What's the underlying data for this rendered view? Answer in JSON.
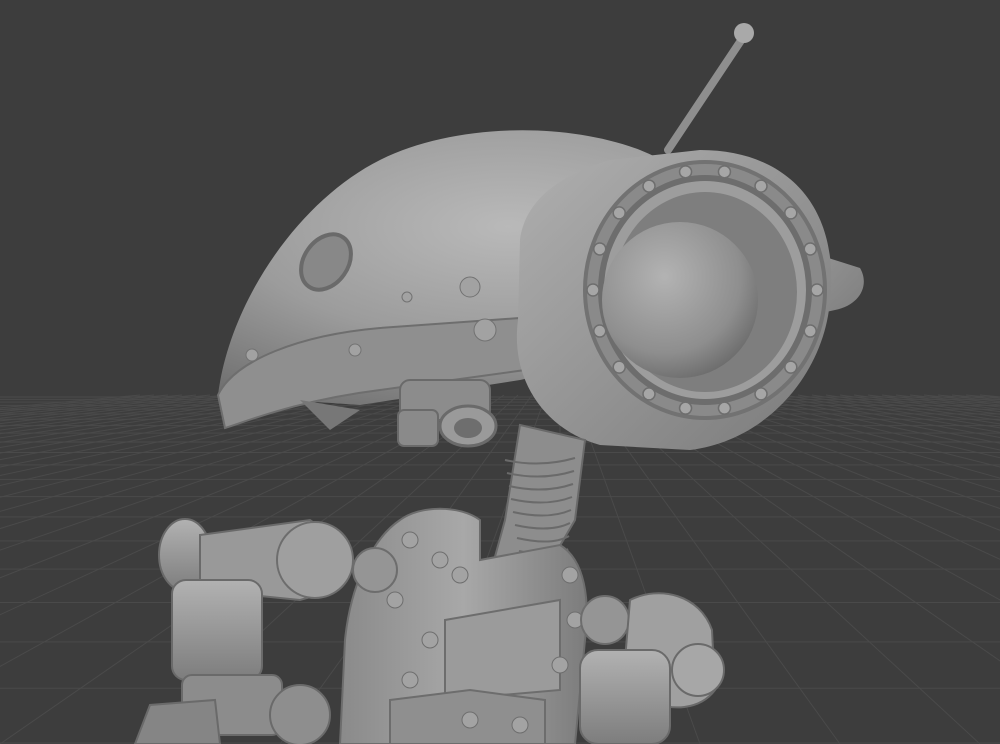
{
  "viewport": {
    "background_color": "#3d3d3d",
    "grid_color": "#4a4a4a",
    "model_base_color": "#9a9a9a",
    "model_shadow_color": "#6e6e6e",
    "model_highlight_color": "#c4c4c4"
  },
  "scene": {
    "subject": "robot-sculpt",
    "shading": "solid-matcap",
    "grid_floor": true
  }
}
